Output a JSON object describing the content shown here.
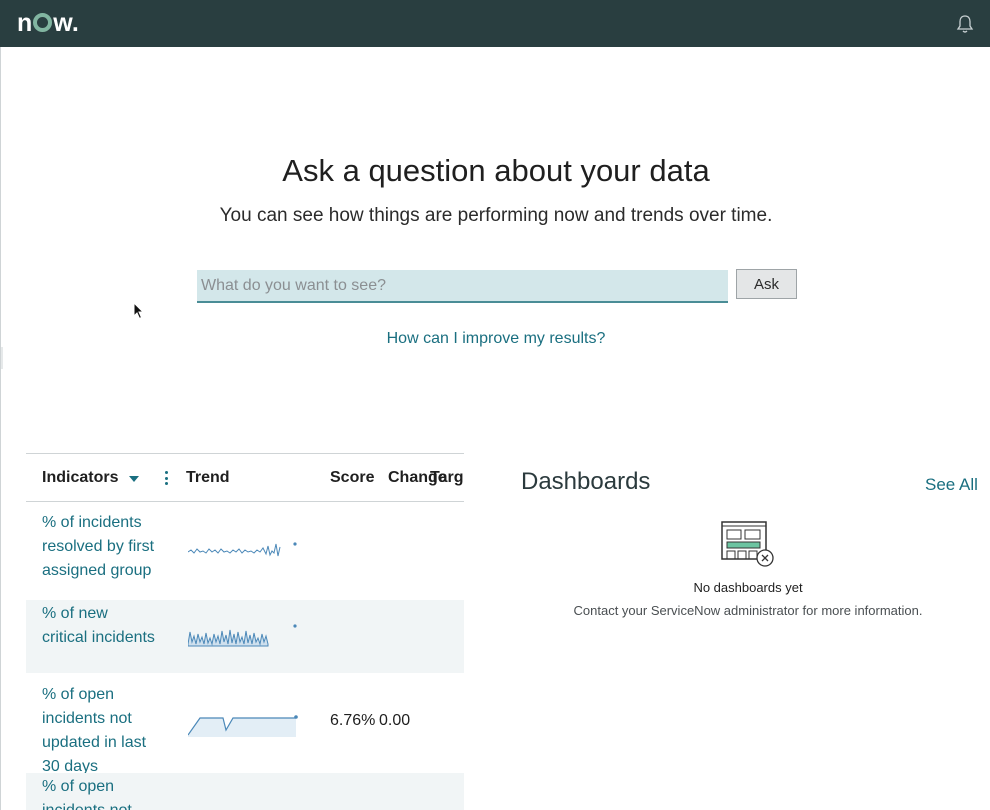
{
  "header": {
    "logo_prefix": "n",
    "logo_suffix": "w",
    "logo_dot": ".",
    "icons": {
      "notifications": "bell-icon"
    },
    "colors": {
      "bar": "#293e40",
      "logo_ring": "#81b5a1"
    }
  },
  "hero": {
    "title": "Ask a question about your data",
    "subtitle": "You can see how things are performing now and trends over time.",
    "search_placeholder": "What do you want to see?",
    "search_value": "",
    "ask_label": "Ask",
    "improve_link": "How can I improve my results?"
  },
  "indicators_table": {
    "columns": {
      "indicators": "Indicators",
      "trend": "Trend",
      "score": "Score",
      "change": "Change",
      "target": "Target"
    },
    "rows": [
      {
        "name": "% of incidents resolved by first assigned group",
        "score": "",
        "change": ""
      },
      {
        "name": "% of new critical incidents",
        "score": "",
        "change": ""
      },
      {
        "name": "% of open incidents not updated in last 30 days",
        "score": "6.76%",
        "change": "0.00"
      },
      {
        "name": "% of open incidents not",
        "score": "",
        "change": ""
      }
    ]
  },
  "dashboards": {
    "title": "Dashboards",
    "see_all": "See All",
    "empty_title": "No dashboards yet",
    "empty_message": "Contact your ServiceNow administrator for more information."
  },
  "accent_color": "#1a6f80"
}
